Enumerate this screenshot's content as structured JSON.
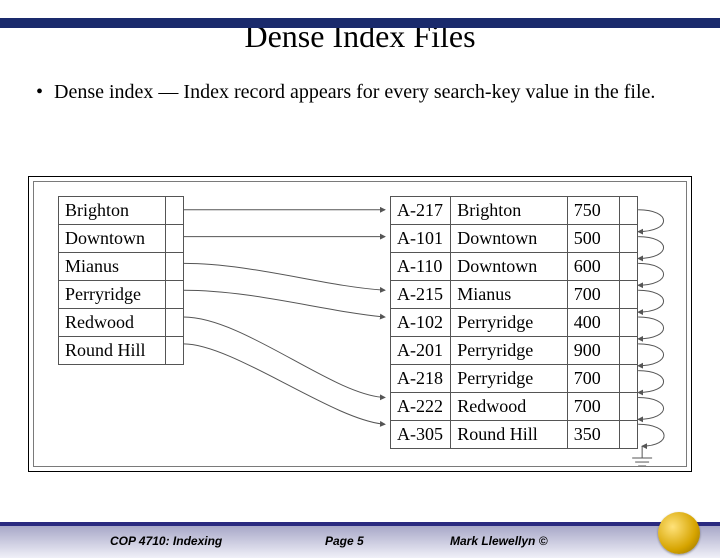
{
  "title": "Dense Index Files",
  "bullet": "Dense index — Index record appears for every search-key value in the file.",
  "index_entries": [
    "Brighton",
    "Downtown",
    "Mianus",
    "Perryridge",
    "Redwood",
    "Round Hill"
  ],
  "data_rows": [
    {
      "acct": "A-217",
      "branch": "Brighton",
      "bal": "750"
    },
    {
      "acct": "A-101",
      "branch": "Downtown",
      "bal": "500"
    },
    {
      "acct": "A-110",
      "branch": "Downtown",
      "bal": "600"
    },
    {
      "acct": "A-215",
      "branch": "Mianus",
      "bal": "700"
    },
    {
      "acct": "A-102",
      "branch": "Perryridge",
      "bal": "400"
    },
    {
      "acct": "A-201",
      "branch": "Perryridge",
      "bal": "900"
    },
    {
      "acct": "A-218",
      "branch": "Perryridge",
      "bal": "700"
    },
    {
      "acct": "A-222",
      "branch": "Redwood",
      "bal": "700"
    },
    {
      "acct": "A-305",
      "branch": "Round Hill",
      "bal": "350"
    }
  ],
  "footer": {
    "course": "COP 4710: Indexing",
    "page": "Page 5",
    "author": "Mark Llewellyn ©"
  }
}
